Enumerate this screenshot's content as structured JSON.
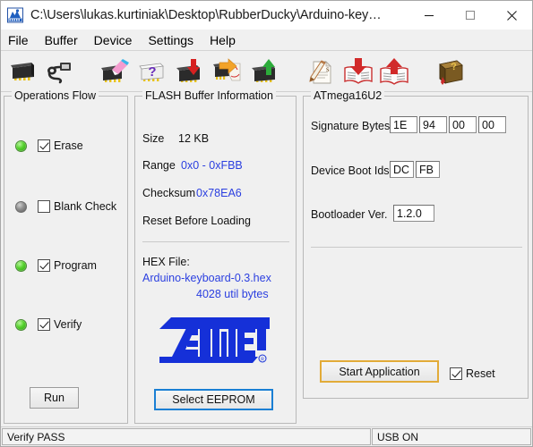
{
  "window": {
    "title": "C:\\Users\\lukas.kurtiniak\\Desktop\\RubberDucky\\Arduino-key…",
    "app_icon": "flip-app-icon",
    "minimize_label": "–",
    "maximize_label": "□",
    "close_label": "✕"
  },
  "menubar": {
    "items": [
      {
        "label": "File"
      },
      {
        "label": "Buffer"
      },
      {
        "label": "Device"
      },
      {
        "label": "Settings"
      },
      {
        "label": "Help"
      }
    ]
  },
  "toolbar": {
    "buttons": [
      {
        "name": "select-device-icon",
        "icon": "chip-icon"
      },
      {
        "name": "select-communication-icon",
        "icon": "usb-cable-icon"
      },
      {
        "name": "erase-icon",
        "icon": "chip-eraser-icon"
      },
      {
        "name": "blank-check-icon",
        "icon": "chip-question-icon"
      },
      {
        "name": "program-icon",
        "icon": "chip-arrow-down-icon"
      },
      {
        "name": "read-icon",
        "icon": "chip-arrow-out-icon"
      },
      {
        "name": "verify-icon",
        "icon": "chip-arrow-up-green-icon"
      },
      {
        "name": "new-file-icon",
        "icon": "document-pencil-icon"
      },
      {
        "name": "load-hex-icon",
        "icon": "book-arrow-down-icon"
      },
      {
        "name": "save-hex-icon",
        "icon": "book-arrow-up-icon"
      },
      {
        "name": "help-icon",
        "icon": "book-question-icon"
      }
    ]
  },
  "operations_flow": {
    "title": "Operations Flow",
    "rows": [
      {
        "label": "Erase",
        "checked": true,
        "led": "green"
      },
      {
        "label": "Blank Check",
        "checked": false,
        "led": "gray"
      },
      {
        "label": "Program",
        "checked": true,
        "led": "green"
      },
      {
        "label": "Verify",
        "checked": true,
        "led": "green"
      }
    ],
    "run_button": "Run"
  },
  "flash_buffer": {
    "title": "FLASH Buffer Information",
    "size_label": "Size",
    "size_value": "12 KB",
    "range_label": "Range",
    "range_value": "0x0 - 0xFBB",
    "checksum_label": "Checksum",
    "checksum_value": "0x78EA6",
    "reset_before_loading": "Reset Before Loading",
    "hex_file_label": "HEX File:",
    "hex_file_name": "Arduino-keyboard-0.3.hex",
    "hex_file_bytes": "4028 util bytes",
    "logo_text": "ATMEL",
    "select_eeprom_button": "Select EEPROM"
  },
  "mcu": {
    "title": "ATmega16U2",
    "signature_label": "Signature Bytes",
    "signature_bytes": [
      "1E",
      "94",
      "00",
      "00"
    ],
    "boot_ids_label": "Device Boot Ids",
    "boot_ids": [
      "DC",
      "FB"
    ],
    "bootloader_label": "Bootloader Ver.",
    "bootloader_value": "1.2.0",
    "start_application_button": "Start Application",
    "reset_checkbox_label": "Reset",
    "reset_checked": true
  },
  "statusbar": {
    "left": "Verify PASS",
    "right": "USB ON"
  },
  "colors": {
    "accent_blue": "#2b3fe0",
    "focus_blue": "#1a7fd4",
    "focus_gold": "#e2ab38",
    "led_green": "#53d12b",
    "window_bg": "#f0f0f0"
  }
}
